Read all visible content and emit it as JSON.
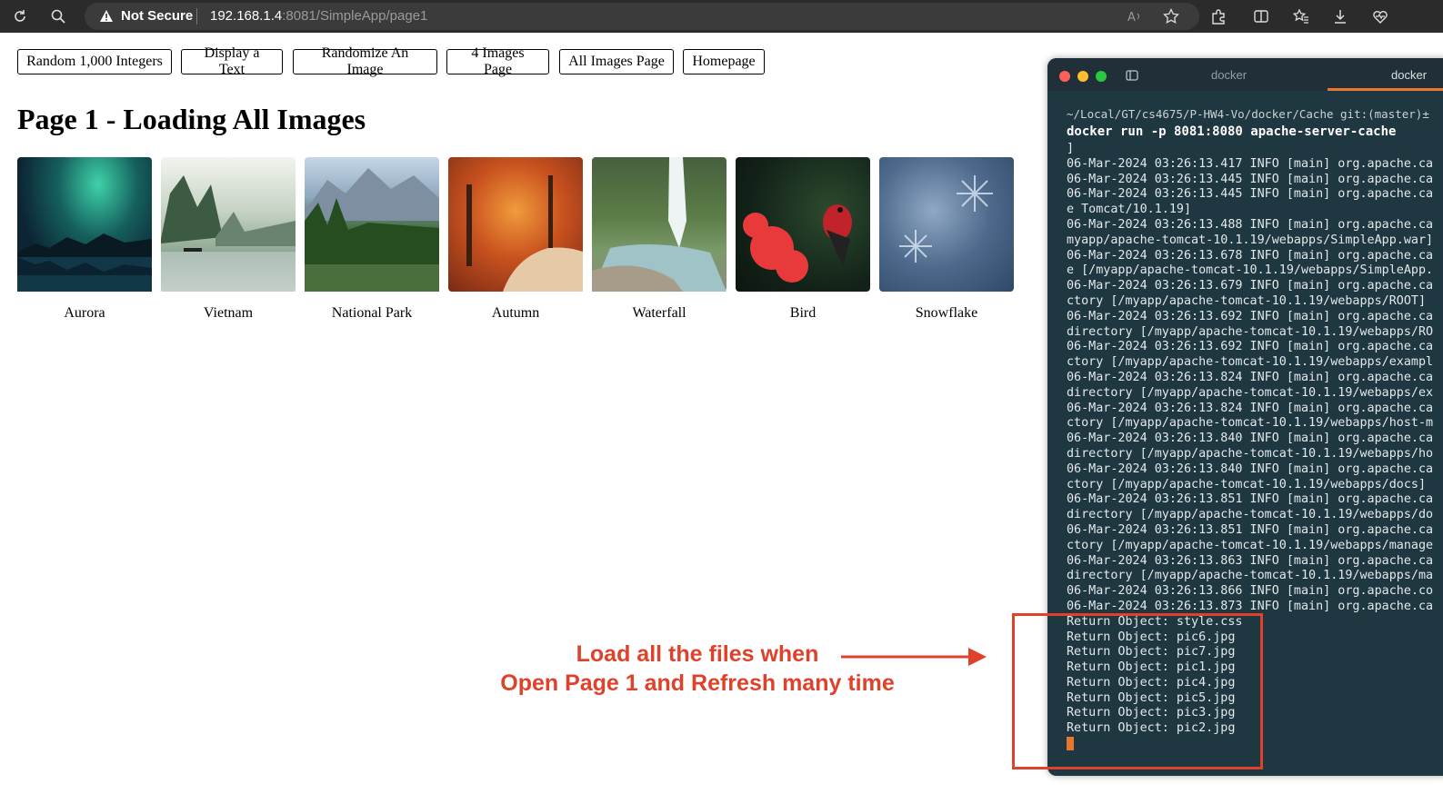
{
  "browser": {
    "not_secure_label": "Not Secure",
    "url_host": "192.168.1.4",
    "url_rest": ":8081/SimpleApp/page1",
    "toolbar_icons": [
      "refresh-icon",
      "search-icon",
      "warning-icon",
      "read-aloud-icon",
      "favorite-star-icon",
      "extensions-icon",
      "split-screen-icon",
      "favorites-icon",
      "download-icon",
      "health-icon"
    ]
  },
  "nav": {
    "buttons": [
      "Random 1,000 Integers",
      "Display a Text",
      "Randomize An Image",
      "4 Images Page",
      "All Images Page",
      "Homepage"
    ]
  },
  "page": {
    "title": "Page 1 - Loading All Images"
  },
  "gallery": {
    "items": [
      {
        "caption": "Aurora"
      },
      {
        "caption": "Vietnam"
      },
      {
        "caption": "National Park"
      },
      {
        "caption": "Autumn"
      },
      {
        "caption": "Waterfall"
      },
      {
        "caption": "Bird"
      },
      {
        "caption": "Snowflake"
      }
    ]
  },
  "terminal": {
    "tab1": "docker",
    "tab2": "docker",
    "prompt": "~/Local/GT/cs4675/P-HW4-Vo/docker/Cache git:(master)±",
    "command": "docker run -p 8081:8080 apache-server-cache",
    "lines": [
      "]",
      "06-Mar-2024 03:26:13.417 INFO [main] org.apache.ca",
      "06-Mar-2024 03:26:13.445 INFO [main] org.apache.ca",
      "06-Mar-2024 03:26:13.445 INFO [main] org.apache.ca",
      "e Tomcat/10.1.19]",
      "06-Mar-2024 03:26:13.488 INFO [main] org.apache.ca",
      "myapp/apache-tomcat-10.1.19/webapps/SimpleApp.war]",
      "06-Mar-2024 03:26:13.678 INFO [main] org.apache.ca",
      "e [/myapp/apache-tomcat-10.1.19/webapps/SimpleApp.",
      "06-Mar-2024 03:26:13.679 INFO [main] org.apache.ca",
      "ctory [/myapp/apache-tomcat-10.1.19/webapps/ROOT]",
      "06-Mar-2024 03:26:13.692 INFO [main] org.apache.ca",
      "directory [/myapp/apache-tomcat-10.1.19/webapps/RO",
      "06-Mar-2024 03:26:13.692 INFO [main] org.apache.ca",
      "ctory [/myapp/apache-tomcat-10.1.19/webapps/exampl",
      "06-Mar-2024 03:26:13.824 INFO [main] org.apache.ca",
      "directory [/myapp/apache-tomcat-10.1.19/webapps/ex",
      "06-Mar-2024 03:26:13.824 INFO [main] org.apache.ca",
      "ctory [/myapp/apache-tomcat-10.1.19/webapps/host-m",
      "06-Mar-2024 03:26:13.840 INFO [main] org.apache.ca",
      "directory [/myapp/apache-tomcat-10.1.19/webapps/ho",
      "06-Mar-2024 03:26:13.840 INFO [main] org.apache.ca",
      "ctory [/myapp/apache-tomcat-10.1.19/webapps/docs]",
      "06-Mar-2024 03:26:13.851 INFO [main] org.apache.ca",
      "directory [/myapp/apache-tomcat-10.1.19/webapps/do",
      "06-Mar-2024 03:26:13.851 INFO [main] org.apache.ca",
      "ctory [/myapp/apache-tomcat-10.1.19/webapps/manage",
      "06-Mar-2024 03:26:13.863 INFO [main] org.apache.ca",
      "directory [/myapp/apache-tomcat-10.1.19/webapps/ma",
      "06-Mar-2024 03:26:13.866 INFO [main] org.apache.co",
      "06-Mar-2024 03:26:13.873 INFO [main] org.apache.ca",
      "Return Object: style.css",
      "Return Object: pic6.jpg",
      "Return Object: pic7.jpg",
      "Return Object: pic1.jpg",
      "Return Object: pic4.jpg",
      "Return Object: pic5.jpg",
      "Return Object: pic3.jpg",
      "Return Object: pic2.jpg"
    ]
  },
  "annotation": {
    "line1": "Load all the files when",
    "line2": "Open Page 1 and Refresh many time",
    "color": "#e0412a"
  }
}
